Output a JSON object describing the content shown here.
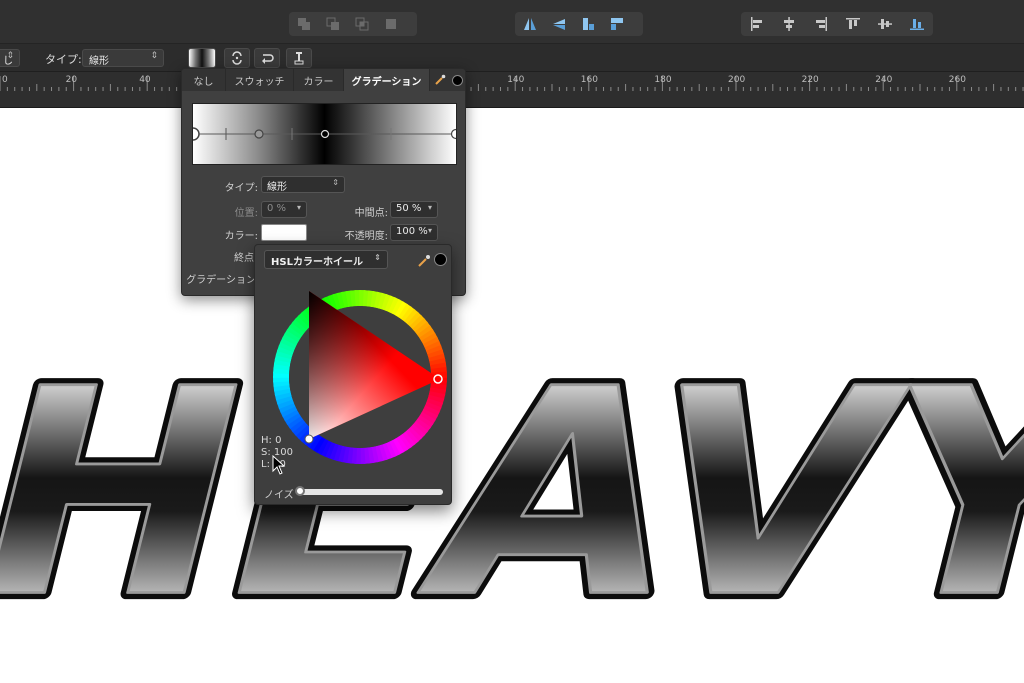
{
  "toolbar": {
    "groups": [
      {
        "name": "boolean-ops",
        "icons": [
          "union-icon",
          "subtract-icon",
          "intersect-icon",
          "divide-icon"
        ]
      },
      {
        "name": "flip-rotate",
        "icons": [
          "flip-horizontal-icon",
          "flip-vertical-icon",
          "rotate-left-icon",
          "rotate-right-icon"
        ]
      },
      {
        "name": "align",
        "icons": [
          "align-left-icon",
          "align-center-icon",
          "align-right-icon",
          "align-top-icon",
          "align-middle-icon",
          "align-bottom-icon"
        ]
      }
    ]
  },
  "context_bar": {
    "left_fragment": "し",
    "type_label": "タイプ:",
    "type_value": "線形"
  },
  "ruler": {
    "labels": [
      "0",
      "20",
      "40",
      "140",
      "160",
      "180",
      "200",
      "220",
      "240",
      "260"
    ]
  },
  "gradient_panel": {
    "tabs": [
      "なし",
      "スウォッチ",
      "カラー",
      "グラデーション"
    ],
    "active_tab": "グラデーション",
    "type_label": "タイプ:",
    "type_value": "線形",
    "position_label": "位置:",
    "position_value": "0 %",
    "midpoint_label": "中間点:",
    "midpoint_value": "50 %",
    "color_label": "カラー:",
    "opacity_label": "不透明度:",
    "opacity_value": "100 %",
    "endpoint_label": "終点",
    "gradation_label": "グラデーション"
  },
  "wheel_panel": {
    "mode": "HSLカラーホイール",
    "h_text": "H: 0",
    "s_text": "S: 100",
    "l_text": "L: 50",
    "noise_label": "ノイズ",
    "noise_level": 0,
    "selected_hue": 0
  },
  "canvas": {
    "artwork_text": "HEAVY"
  },
  "colors": {
    "panel_bg": "#404040",
    "toolbar_bg": "#303030",
    "accent_blue": "#6aaee8",
    "selected_color": "#ff0000"
  }
}
